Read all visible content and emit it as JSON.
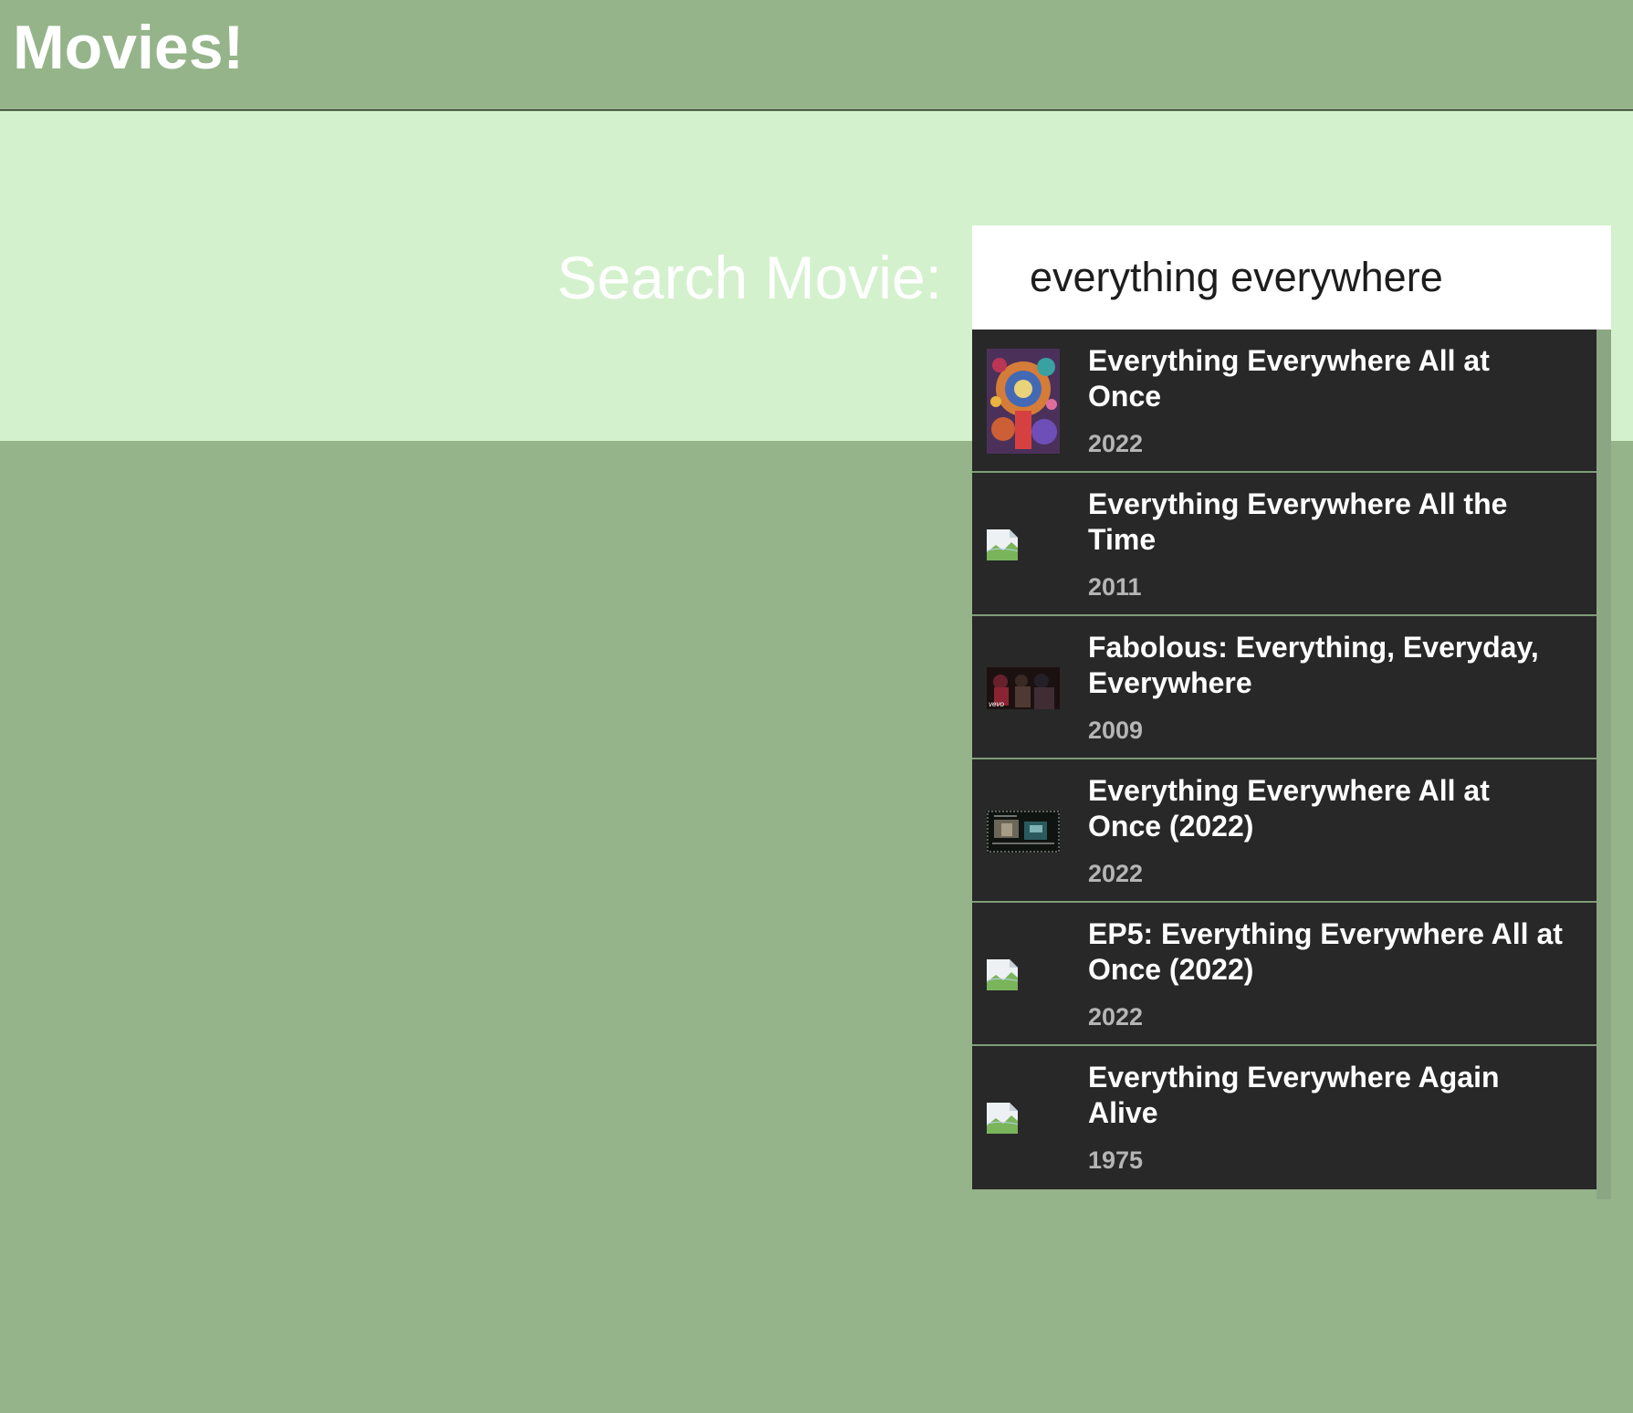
{
  "header": {
    "title": "Movies!"
  },
  "search": {
    "label": "Search Movie:",
    "value": "everything everywhere"
  },
  "results": [
    {
      "title": "Everything Everywhere All at Once",
      "year": "2022",
      "poster": "poster-colorful"
    },
    {
      "title": "Everything Everywhere All the Time",
      "year": "2011",
      "poster": "broken-image-icon"
    },
    {
      "title": "Fabolous: Everything, Everyday, Everywhere",
      "year": "2009",
      "poster": "poster-music-video",
      "poster_text": "vevo"
    },
    {
      "title": "Everything Everywhere All at Once (2022)",
      "year": "2022",
      "poster": "poster-podcast"
    },
    {
      "title": "EP5: Everything Everywhere All at Once (2022)",
      "year": "2022",
      "poster": "broken-image-icon"
    },
    {
      "title": "Everything Everywhere Again Alive",
      "year": "1975",
      "poster": "broken-image-icon"
    }
  ],
  "colors": {
    "background": "#95b48a",
    "search_band": "#d4f1cd",
    "results_bg": "#282828",
    "year_text": "#b5b5b5"
  }
}
